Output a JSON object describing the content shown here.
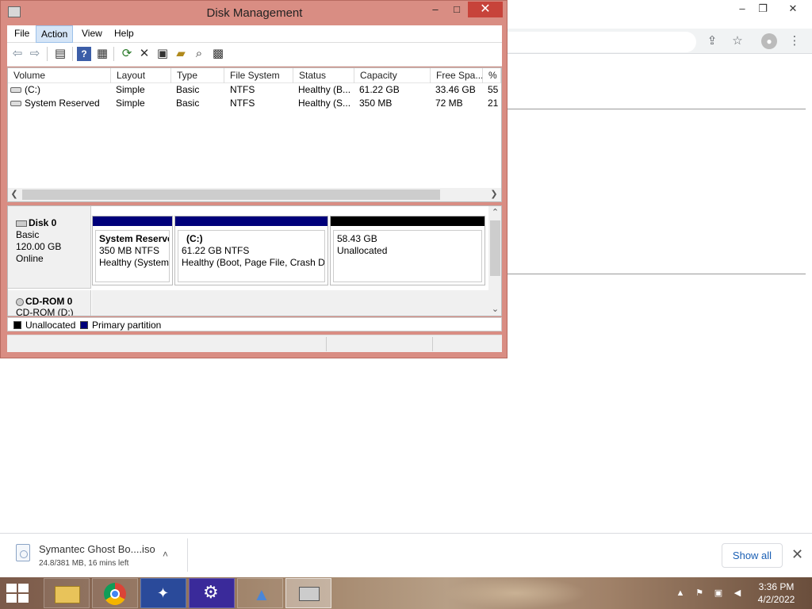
{
  "window": {
    "title": "Disk Management",
    "controls": {
      "minimize": "–",
      "maximize": "□",
      "close": "✕"
    }
  },
  "menu": {
    "items": [
      {
        "label": "File"
      },
      {
        "label": "Action",
        "active": true
      },
      {
        "label": "View"
      },
      {
        "label": "Help"
      }
    ]
  },
  "toolbar": {
    "icons": [
      "back-icon",
      "forward-icon",
      "console-tree-icon",
      "help-icon",
      "properties-icon",
      "refresh-icon",
      "delete-icon",
      "settings-icon",
      "open-icon",
      "rescan-icon",
      "disk-properties-icon"
    ]
  },
  "volume_list": {
    "columns": [
      "Volume",
      "Layout",
      "Type",
      "File System",
      "Status",
      "Capacity",
      "Free Spa...",
      "% F"
    ],
    "rows": [
      {
        "volume": "(C:)",
        "layout": "Simple",
        "type": "Basic",
        "fs": "NTFS",
        "status": "Healthy (B...",
        "capacity": "61.22 GB",
        "free": "33.46 GB",
        "pct": "55"
      },
      {
        "volume": "System Reserved",
        "layout": "Simple",
        "type": "Basic",
        "fs": "NTFS",
        "status": "Healthy (S...",
        "capacity": "350 MB",
        "free": "72 MB",
        "pct": "21"
      }
    ]
  },
  "disks": {
    "disk0": {
      "name": "Disk 0",
      "type": "Basic",
      "size": "120.00 GB",
      "state": "Online"
    },
    "partitions": [
      {
        "name": "System Reserve",
        "size": "350 MB NTFS",
        "status": "Healthy (System,",
        "color": "#00007a"
      },
      {
        "name": "(C:)",
        "size": "61.22 GB NTFS",
        "status": "Healthy (Boot, Page File, Crash Du",
        "color": "#00007a"
      },
      {
        "name": "",
        "size": "58.43 GB",
        "status": "Unallocated",
        "color": "#000000"
      }
    ],
    "cdrom": {
      "name": "CD-ROM 0",
      "drive": "CD-ROM (D:)"
    }
  },
  "legend": {
    "unallocated": {
      "label": "Unallocated",
      "color": "#000000"
    },
    "primary": {
      "label": "Primary partition",
      "color": "#00007a"
    }
  },
  "browser": {
    "controls": {
      "minimize": "–",
      "restore": "❐",
      "close": "✕"
    },
    "icons": [
      "share-icon",
      "star-icon",
      "profile-icon",
      "kebab-menu-icon"
    ]
  },
  "download": {
    "filename": "Symantec Ghost Bo....iso",
    "status": "24.8/381 MB, 16 mins left",
    "show_all": "Show all",
    "close": "✕",
    "chevron": "˄"
  },
  "taskbar": {
    "time": "3:36 PM",
    "date": "4/2/2022",
    "apps": [
      "file-explorer-icon",
      "chrome-icon",
      "app-icon",
      "settings-icon",
      "app-blue-icon",
      "disk-management-icon"
    ]
  }
}
